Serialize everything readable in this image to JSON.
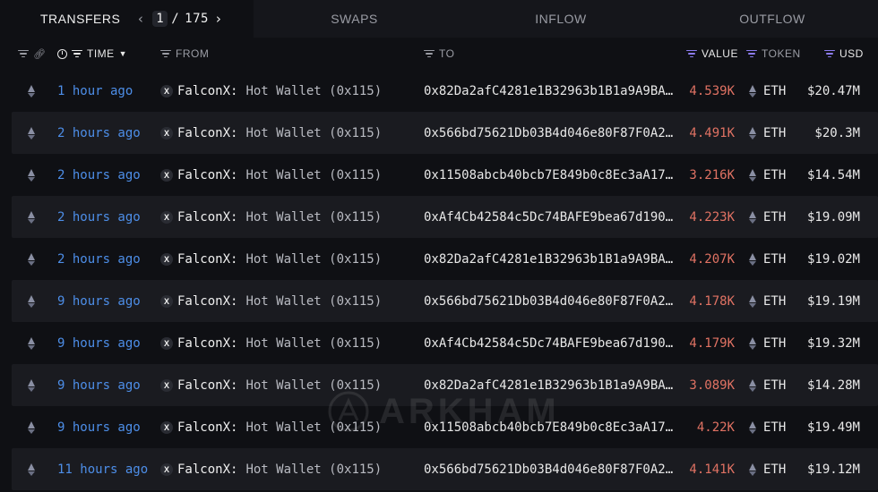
{
  "tabs": {
    "transfers": "TRANSFERS",
    "swaps": "SWAPS",
    "inflow": "INFLOW",
    "outflow": "OUTFLOW"
  },
  "pager": {
    "current": "1",
    "separator": "/",
    "total": "175"
  },
  "columns": {
    "time": "TIME",
    "from": "FROM",
    "to": "TO",
    "value": "VALUE",
    "token": "TOKEN",
    "usd": "USD"
  },
  "rows": [
    {
      "time": "1 hour ago",
      "from_name": "FalconX:",
      "from_rest": "Hot Wallet (0x115)",
      "to": "0x82Da2afC4281e1B32963b1B1a9A9BA…",
      "value": "4.539K",
      "token": "ETH",
      "usd": "$20.47M"
    },
    {
      "time": "2 hours ago",
      "from_name": "FalconX:",
      "from_rest": "Hot Wallet (0x115)",
      "to": "0x566bd75621Db03B4d046e80F87F0A2…",
      "value": "4.491K",
      "token": "ETH",
      "usd": "$20.3M"
    },
    {
      "time": "2 hours ago",
      "from_name": "FalconX:",
      "from_rest": "Hot Wallet (0x115)",
      "to": "0x11508abcb40bcb7E849b0c8Ec3aA17…",
      "value": "3.216K",
      "token": "ETH",
      "usd": "$14.54M"
    },
    {
      "time": "2 hours ago",
      "from_name": "FalconX:",
      "from_rest": "Hot Wallet (0x115)",
      "to": "0xAf4Cb42584c5Dc74BAFE9bea67d190…",
      "value": "4.223K",
      "token": "ETH",
      "usd": "$19.09M"
    },
    {
      "time": "2 hours ago",
      "from_name": "FalconX:",
      "from_rest": "Hot Wallet (0x115)",
      "to": "0x82Da2afC4281e1B32963b1B1a9A9BA…",
      "value": "4.207K",
      "token": "ETH",
      "usd": "$19.02M"
    },
    {
      "time": "9 hours ago",
      "from_name": "FalconX:",
      "from_rest": "Hot Wallet (0x115)",
      "to": "0x566bd75621Db03B4d046e80F87F0A2…",
      "value": "4.178K",
      "token": "ETH",
      "usd": "$19.19M"
    },
    {
      "time": "9 hours ago",
      "from_name": "FalconX:",
      "from_rest": "Hot Wallet (0x115)",
      "to": "0xAf4Cb42584c5Dc74BAFE9bea67d190…",
      "value": "4.179K",
      "token": "ETH",
      "usd": "$19.32M"
    },
    {
      "time": "9 hours ago",
      "from_name": "FalconX:",
      "from_rest": "Hot Wallet (0x115)",
      "to": "0x82Da2afC4281e1B32963b1B1a9A9BA…",
      "value": "3.089K",
      "token": "ETH",
      "usd": "$14.28M"
    },
    {
      "time": "9 hours ago",
      "from_name": "FalconX:",
      "from_rest": "Hot Wallet (0x115)",
      "to": "0x11508abcb40bcb7E849b0c8Ec3aA17…",
      "value": "4.22K",
      "token": "ETH",
      "usd": "$19.49M"
    },
    {
      "time": "11 hours ago",
      "from_name": "FalconX:",
      "from_rest": "Hot Wallet (0x115)",
      "to": "0x566bd75621Db03B4d046e80F87F0A2…",
      "value": "4.141K",
      "token": "ETH",
      "usd": "$19.12M"
    }
  ],
  "watermark": {
    "text": "ARKHAM"
  },
  "colors": {
    "background": "#0f1014",
    "alt_row": "#1a1b20",
    "time_link": "#4d8ee8",
    "value_out": "#e07263",
    "sort_accent": "#8d7cf0"
  },
  "icons": {
    "row_token": "ethereum-icon",
    "entity": "falconx-x-icon",
    "filter": "filter-icon",
    "link": "link-icon",
    "clock": "clock-icon"
  }
}
